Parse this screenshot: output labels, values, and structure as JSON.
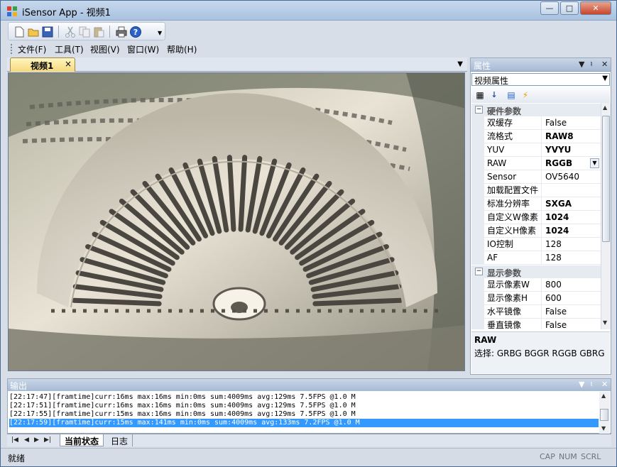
{
  "window": {
    "title": "iSensor App - 视频1"
  },
  "menu": [
    "文件(F)",
    "工具(T)",
    "视图(V)",
    "窗口(W)",
    "帮助(H)"
  ],
  "toolbar": [
    "new-icon",
    "open-icon",
    "save-icon",
    "cut-icon",
    "copy-icon",
    "paste-icon",
    "print-icon",
    "help-icon"
  ],
  "doc_tab": {
    "label": "视频1",
    "close": "×"
  },
  "properties": {
    "title": "属性",
    "combo": "视频属性",
    "categories": [
      {
        "label": "硬件参数",
        "rows": [
          {
            "name": "双缓存",
            "value": "False",
            "bold": false
          },
          {
            "name": "流格式",
            "value": "RAW8",
            "bold": true
          },
          {
            "name": "YUV",
            "value": "YVYU",
            "bold": true
          },
          {
            "name": "RAW",
            "value": "RGGB",
            "bold": true
          },
          {
            "name": "Sensor",
            "value": "OV5640",
            "bold": false
          },
          {
            "name": "加载配置文件",
            "value": "",
            "bold": false
          },
          {
            "name": "标准分辨率",
            "value": "SXGA",
            "bold": true
          },
          {
            "name": "自定义W像素",
            "value": "1024",
            "bold": true
          },
          {
            "name": "自定义H像素",
            "value": "1024",
            "bold": true
          },
          {
            "name": "IO控制",
            "value": "128",
            "bold": false
          },
          {
            "name": "AF",
            "value": "128",
            "bold": false
          }
        ]
      },
      {
        "label": "显示参数",
        "rows": [
          {
            "name": "显示像素W",
            "value": "800",
            "bold": false
          },
          {
            "name": "显示像素H",
            "value": "600",
            "bold": false
          },
          {
            "name": "水平镜像",
            "value": "False",
            "bold": false
          },
          {
            "name": "垂直镜像",
            "value": "False",
            "bold": false
          }
        ]
      }
    ],
    "description": {
      "title": "RAW",
      "text": "选择: GRBG BGGR RGGB GBRG"
    }
  },
  "output": {
    "title": "输出",
    "lines": [
      "[22:17:47][framtime]curr:16ms max:16ms min:0ms sum:4009ms avg:129ms 7.5FPS @1.0 M",
      "[22:17:51][framtime]curr:16ms max:16ms min:0ms sum:4009ms avg:129ms 7.5FPS @1.0 M",
      "[22:17:55][framtime]curr:15ms max:16ms min:0ms sum:4009ms avg:129ms 7.5FPS @1.0 M",
      "[22:17:59][framtime]curr:15ms max:141ms min:0ms sum:4009ms avg:133ms 7.2FPS @1.0 M"
    ],
    "selected_index": 3
  },
  "bottom_tabs": [
    "当前状态",
    "日志"
  ],
  "status": {
    "text": "就绪",
    "indicators": [
      "CAP",
      "NUM",
      "SCRL"
    ]
  }
}
